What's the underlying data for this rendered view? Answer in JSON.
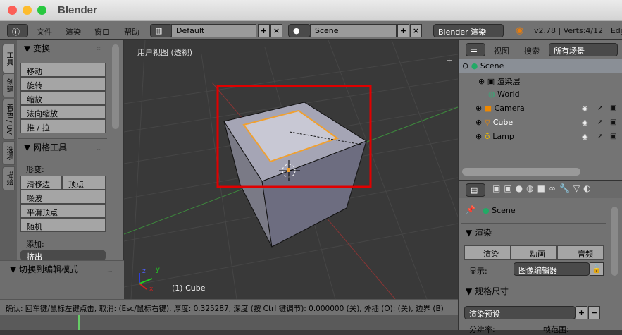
{
  "window": {
    "title": "Blender"
  },
  "topbar": {
    "menus": [
      "文件",
      "渲染",
      "窗口",
      "帮助"
    ],
    "layout": "Default",
    "scene": "Scene",
    "engine": "Blender 渲染",
    "info": "v2.78 | Verts:4/12 | Edge"
  },
  "tools_panel": {
    "tabs": [
      "工具",
      "创建",
      "着色 / UV",
      "选项",
      "描绘"
    ],
    "transform": {
      "title": "变换",
      "buttons": [
        "移动",
        "旋转",
        "缩放",
        "法向缩放",
        "推 / 拉"
      ]
    },
    "mesh_tools": {
      "title": "网格工具",
      "deform_label": "形变:",
      "slide_edge": "滑移边线",
      "vertex": "顶点",
      "buttons": [
        "噪波",
        "平滑顶点",
        "随机"
      ],
      "add_label": "添加:",
      "extrude": "挤出"
    },
    "operator": {
      "title": "切换到编辑模式"
    }
  },
  "viewport": {
    "view_label": "用户视图 (透视)",
    "object_label": "(1) Cube",
    "axes": {
      "z": "z",
      "y": "y",
      "x": "x"
    },
    "selection_box_color": "#e00000"
  },
  "outliner": {
    "menus": [
      "视图",
      "搜索"
    ],
    "filter": "所有场景",
    "items": [
      {
        "name": "Scene"
      },
      {
        "name": "渲染层"
      },
      {
        "name": "World"
      },
      {
        "name": "Camera"
      },
      {
        "name": "Cube"
      },
      {
        "name": "Lamp"
      }
    ]
  },
  "properties": {
    "context": "Scene",
    "render": {
      "title": "渲染",
      "buttons": [
        "渲染",
        "动画",
        "音频"
      ],
      "display_label": "显示:",
      "display_value": "图像编辑器"
    },
    "dimensions": {
      "title": "规格尺寸",
      "preset": "渲染预设",
      "resolution": "分辨率:",
      "frame_range": "帧范围:"
    }
  },
  "status": {
    "text": "确认: 回车键/鼠标左键点击, 取消: (Esc/鼠标右键), 厚度: 0.325287, 深度 (按 Ctrl 键调节): 0.000000 (关), 外插 (O): (关), 边界 (B)"
  }
}
